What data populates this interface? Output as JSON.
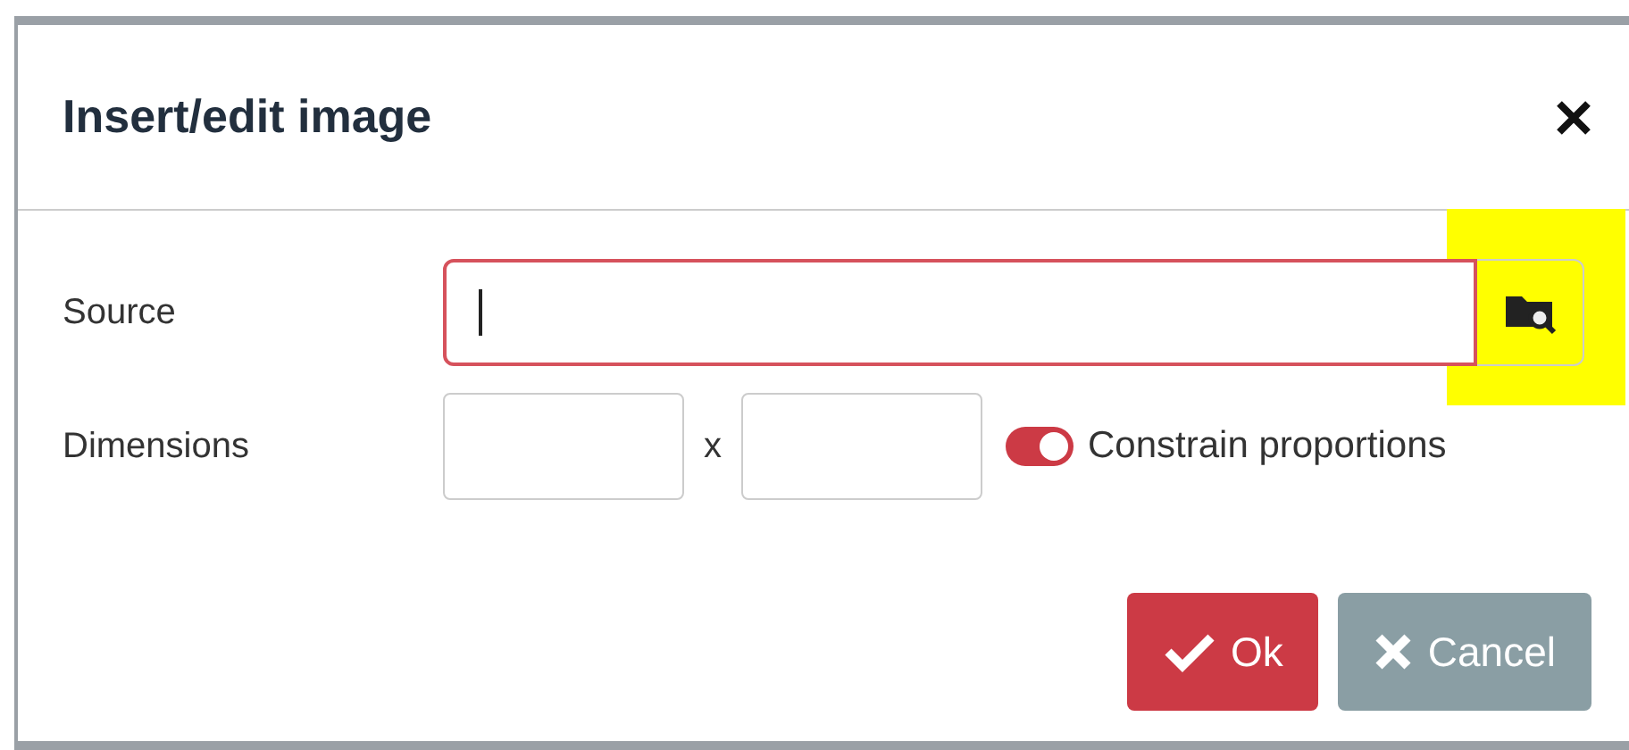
{
  "dialog": {
    "title": "Insert/edit image"
  },
  "source": {
    "label": "Source",
    "focused": true,
    "highlighted": true
  },
  "dimensions": {
    "label": "Dimensions",
    "separator": "x",
    "constrain": {
      "label": "Constrain proportions",
      "on": true
    }
  },
  "buttons": [
    {
      "label": "Ok",
      "kind": "primary"
    },
    {
      "label": "Cancel",
      "kind": "secondary"
    }
  ]
}
